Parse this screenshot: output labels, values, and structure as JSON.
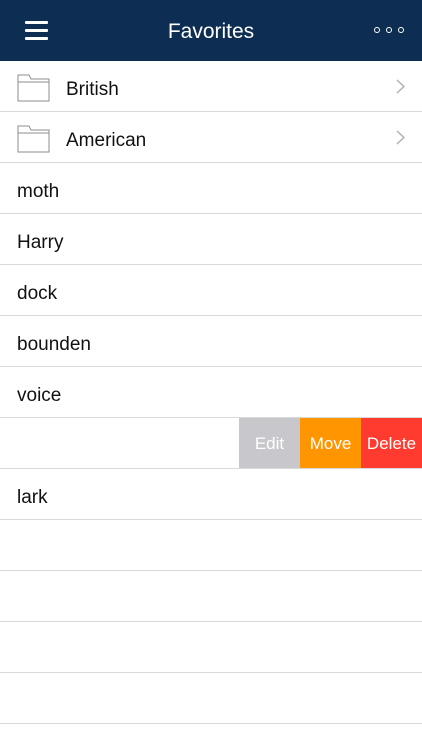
{
  "header": {
    "title": "Favorites",
    "background": "#0d2d52",
    "menu_icon": "hamburger-menu-icon",
    "more_icon": "more-options-icon"
  },
  "folders": [
    {
      "label": "British",
      "icon": "folder-icon"
    },
    {
      "label": "American",
      "icon": "folder-icon"
    }
  ],
  "words": [
    "moth",
    "Harry",
    "dock",
    "bounden",
    "voice"
  ],
  "swipe_actions": {
    "edit": {
      "label": "Edit",
      "color": "#c8c7cc"
    },
    "move": {
      "label": "Move",
      "color": "#ff9500"
    },
    "delete": {
      "label": "Delete",
      "color": "#ff3b30"
    }
  },
  "words_after": [
    "lark"
  ]
}
